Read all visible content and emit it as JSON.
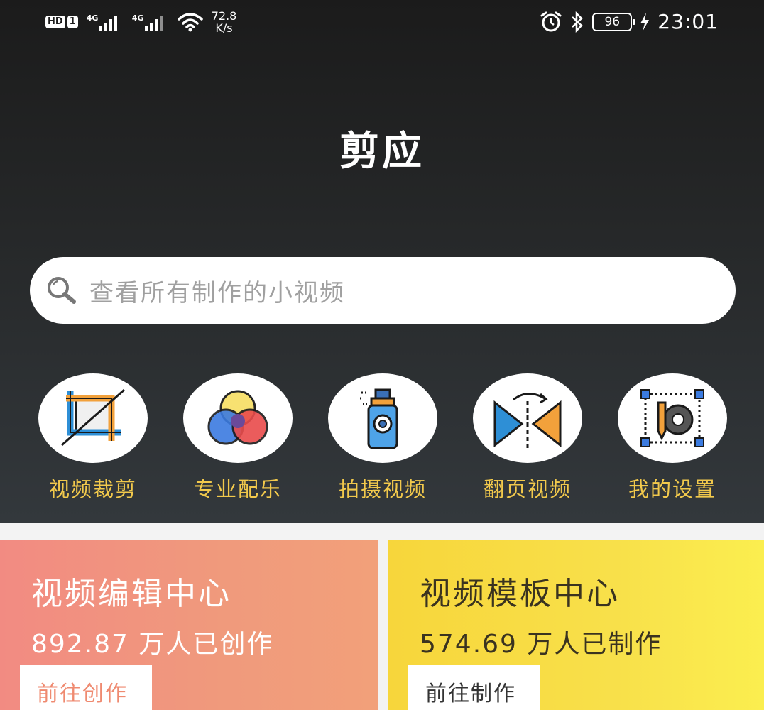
{
  "status_bar": {
    "hd_badge": "HD",
    "sim_badge": "1",
    "sim1_label": "4G",
    "sim2_label": "4G",
    "speed_value": "72.8",
    "speed_unit": "K/s",
    "battery": "96",
    "time": "23:01"
  },
  "app": {
    "title": "剪应"
  },
  "search": {
    "placeholder": "查看所有制作的小视频"
  },
  "features": [
    {
      "label": "视频裁剪",
      "icon": "crop-icon"
    },
    {
      "label": "专业配乐",
      "icon": "color-circles-icon"
    },
    {
      "label": "拍摄视频",
      "icon": "spray-camera-icon"
    },
    {
      "label": "翻页视频",
      "icon": "flip-icon"
    },
    {
      "label": "我的设置",
      "icon": "settings-gear-icon"
    }
  ],
  "cards": {
    "edit": {
      "title": "视频编辑中心",
      "count": "892.87 万人已创作",
      "button": "前往创作"
    },
    "template": {
      "title": "视频模板中心",
      "count": "574.69 万人已制作",
      "button": "前往制作"
    }
  },
  "colors": {
    "feature_label": "#f2c94c",
    "edit_card": "#f28b82",
    "template_card": "#f8e04a",
    "edit_button_text": "#ef8a70"
  }
}
